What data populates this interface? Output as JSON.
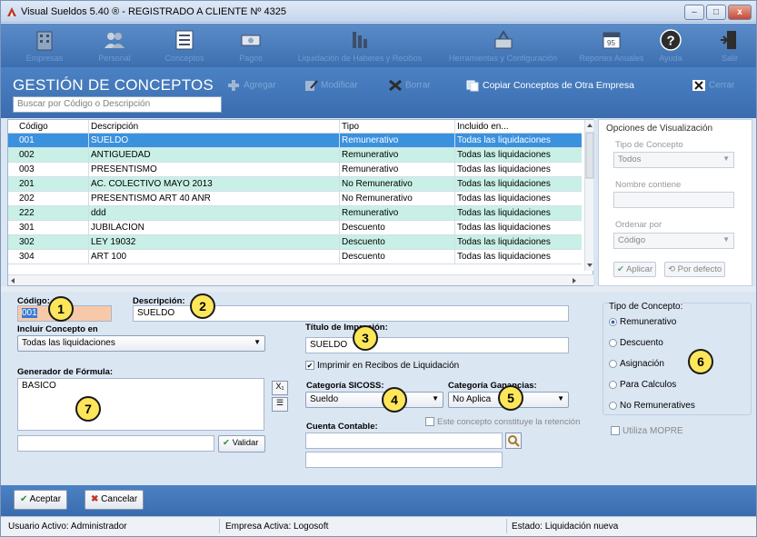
{
  "window": {
    "title": "Visual Sueldos 5.40 ®    - REGISTRADO A CLIENTE Nº 4325",
    "minimize": "–",
    "maximize": "□",
    "close": "x"
  },
  "toolbar": {
    "items": [
      {
        "label": "Empresas",
        "icon": "building-icon"
      },
      {
        "label": "Personal",
        "icon": "people-icon"
      },
      {
        "label": "Conceptos",
        "icon": "list-icon"
      },
      {
        "label": "Pagos",
        "icon": "money-icon"
      },
      {
        "label": "Liquidación de Haberes y Recibos",
        "icon": "factory-icon"
      },
      {
        "label": "Herramientas y Configuración",
        "icon": "tools-icon"
      },
      {
        "label": "Reportes Anuales",
        "icon": "calendar-icon"
      },
      {
        "label": "Ayuda",
        "icon": "help-icon"
      },
      {
        "label": "Salir",
        "icon": "exit-icon"
      }
    ]
  },
  "header": {
    "title": "GESTIÓN DE CONCEPTOS",
    "agregar": "Agregar",
    "modificar": "Modificar",
    "borrar": "Borrar",
    "copiar": "Copiar Conceptos de Otra Empresa",
    "cerrar": "Cerrar",
    "search_placeholder": "Buscar por Código o Descripción"
  },
  "grid": {
    "columns": [
      "Código",
      "Descripción",
      "Tipo",
      "Incluido en..."
    ],
    "rows": [
      [
        "001",
        "SUELDO",
        "Remunerativo",
        "Todas las liquidaciones"
      ],
      [
        "002",
        "ANTIGUEDAD",
        "Remunerativo",
        "Todas las liquidaciones"
      ],
      [
        "003",
        "PRESENTISMO",
        "Remunerativo",
        "Todas las liquidaciones"
      ],
      [
        "201",
        "AC. COLECTIVO MAYO 2013",
        "No Remunerativo",
        "Todas las liquidaciones"
      ],
      [
        "202",
        "PRESENTISMO ART 40 ANR",
        "No Remunerativo",
        "Todas las liquidaciones"
      ],
      [
        "222",
        "ddd",
        "Remunerativo",
        "Todas las liquidaciones"
      ],
      [
        "301",
        "JUBILACION",
        "Descuento",
        "Todas las liquidaciones"
      ],
      [
        "302",
        "LEY 19032",
        "Descuento",
        "Todas las liquidaciones"
      ],
      [
        "304",
        "ART 100",
        "Descuento",
        "Todas las liquidaciones"
      ]
    ]
  },
  "options": {
    "title": "Opciones de Visualización",
    "tipo_label": "Tipo de Concepto",
    "tipo_value": "Todos",
    "nombre_label": "Nombre contiene",
    "nombre_value": "",
    "orden_label": "Ordenar por",
    "orden_value": "Código",
    "aplicar": "Aplicar",
    "defecto": "Por defecto"
  },
  "form": {
    "codigo_label": "Código:",
    "codigo_value": "001",
    "descripcion_label": "Descripción:",
    "descripcion_value": "SUELDO",
    "incluir_label": "Incluir Concepto en",
    "incluir_value": "Todas las liquidaciones",
    "titulo_label": "Título de Impresión:",
    "titulo_value": "SUELDO",
    "imprimir_label": "Imprimir en Recibos de Liquidación",
    "generador_label": "Generador de Fórmula:",
    "generador_value": "BASICO",
    "validar": "Validar",
    "sicoss_label": "Categoría SICOSS:",
    "sicoss_value": "Sueldo",
    "ganancias_label": "Categoría Ganancias:",
    "ganancias_value": "No Aplica",
    "retencion_label": "Este concepto constituye la retención",
    "cuenta_label": "Cuenta Contable:",
    "cuenta_value": "",
    "cuenta_value2": "",
    "formula_input": ""
  },
  "tipo_concepto": {
    "title": "Tipo de Concepto:",
    "options": [
      "Remunerativo",
      "Descuento",
      "Asignación",
      "Para Calculos",
      "No Remuneratives"
    ],
    "selected": "Remunerativo",
    "mopre": "Utiliza MOPRE"
  },
  "badges": [
    "1",
    "2",
    "3",
    "4",
    "5",
    "6",
    "7"
  ],
  "footer": {
    "aceptar": "Aceptar",
    "cancelar": "Cancelar"
  },
  "status": {
    "usuario": "Usuario Activo: Administrador",
    "empresa": "Empresa Activa: Logosoft",
    "estado": "Estado: Liquidación nueva"
  },
  "colors": {
    "selected_row": "#3a91de",
    "alt_row": "#c8f0e6",
    "header_blue": "#3d6fb0",
    "badge": "#fde65a"
  }
}
